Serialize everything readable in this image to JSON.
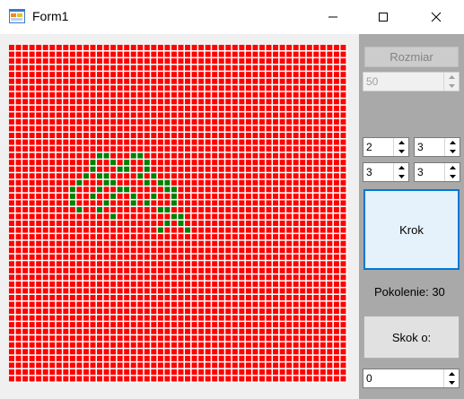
{
  "window": {
    "title": "Form1",
    "icon": "winforms-app-icon",
    "controls": [
      "minimize-icon",
      "maximize-icon",
      "close-icon"
    ]
  },
  "board": {
    "size": 50,
    "dead_color": "#ff0000",
    "alive_color": "#008000",
    "gridline_color": "#ffffff",
    "live_cells": [
      [
        13,
        16
      ],
      [
        14,
        16
      ],
      [
        18,
        16
      ],
      [
        19,
        16
      ],
      [
        12,
        17
      ],
      [
        15,
        17
      ],
      [
        17,
        17
      ],
      [
        20,
        17
      ],
      [
        12,
        18
      ],
      [
        16,
        18
      ],
      [
        17,
        18
      ],
      [
        20,
        18
      ],
      [
        11,
        19
      ],
      [
        13,
        19
      ],
      [
        14,
        19
      ],
      [
        19,
        19
      ],
      [
        21,
        19
      ],
      [
        10,
        20
      ],
      [
        14,
        20
      ],
      [
        15,
        20
      ],
      [
        20,
        20
      ],
      [
        22,
        20
      ],
      [
        23,
        20
      ],
      [
        9,
        21
      ],
      [
        13,
        21
      ],
      [
        16,
        21
      ],
      [
        17,
        21
      ],
      [
        23,
        21
      ],
      [
        24,
        21
      ],
      [
        9,
        22
      ],
      [
        12,
        22
      ],
      [
        15,
        22
      ],
      [
        18,
        22
      ],
      [
        21,
        22
      ],
      [
        24,
        22
      ],
      [
        9,
        23
      ],
      [
        14,
        23
      ],
      [
        18,
        23
      ],
      [
        20,
        23
      ],
      [
        24,
        23
      ],
      [
        10,
        24
      ],
      [
        13,
        24
      ],
      [
        22,
        24
      ],
      [
        23,
        24
      ],
      [
        15,
        25
      ],
      [
        24,
        25
      ],
      [
        25,
        25
      ],
      [
        23,
        26
      ],
      [
        25,
        26
      ],
      [
        22,
        27
      ],
      [
        26,
        27
      ]
    ]
  },
  "panel": {
    "size_button": "Rozmiar",
    "size_value": "50",
    "rules": {
      "a": "2",
      "b": "3",
      "c": "3",
      "d": "3"
    },
    "step_button": "Krok",
    "generation_label": "Pokolenie: 30",
    "jump_button": "Skok o:",
    "jump_value": "0"
  }
}
